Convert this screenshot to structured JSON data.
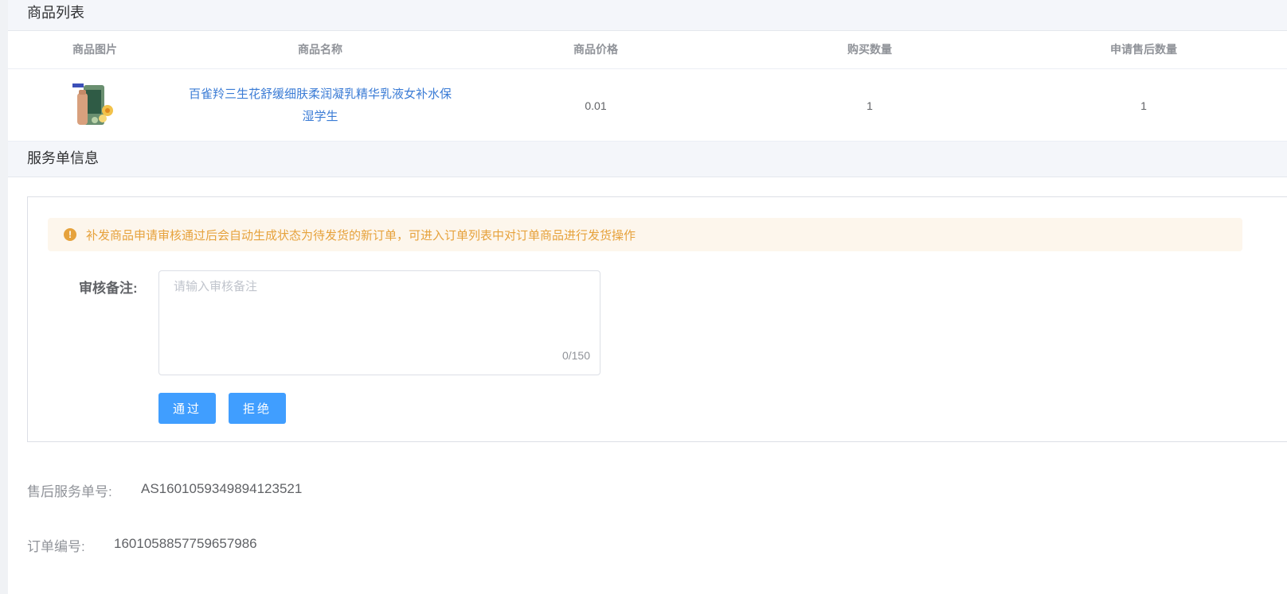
{
  "goods_section": {
    "title": "商品列表",
    "columns": [
      "商品图片",
      "商品名称",
      "商品价格",
      "购买数量",
      "申请售后数量"
    ],
    "rows": [
      {
        "image_alt": "product-image",
        "name": "百雀羚三生花舒缓细肤柔润凝乳精华乳液女补水保湿学生",
        "price": "0.01",
        "quantity": "1",
        "aftersale_quantity": "1"
      }
    ]
  },
  "service_section": {
    "title": "服务单信息",
    "alert_text": "补发商品申请审核通过后会自动生成状态为待发货的新订单，可进入订单列表中对订单商品进行发货操作",
    "remark_label": "审核备注:",
    "remark_placeholder": "请输入审核备注",
    "remark_value": "",
    "remark_counter": "0/150",
    "approve_label": "通过",
    "reject_label": "拒绝"
  },
  "info": {
    "service_no_label": "售后服务单号:",
    "service_no_value": "AS1601059349894123521",
    "order_no_label": "订单编号:",
    "order_no_value": "1601058857759657986"
  },
  "colors": {
    "primary": "#409eff",
    "warning": "#e6a23c",
    "link": "#3a7bd5"
  }
}
